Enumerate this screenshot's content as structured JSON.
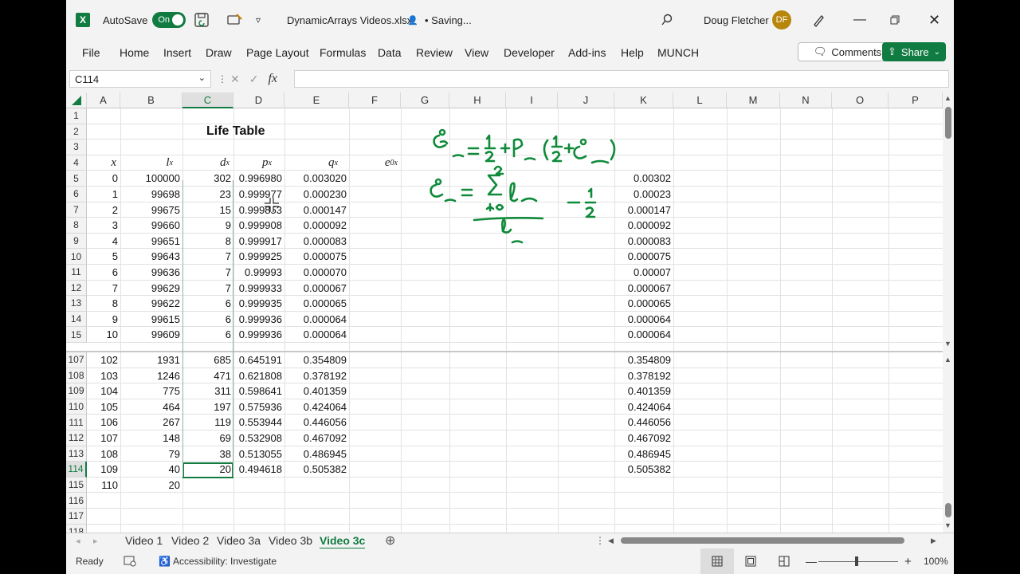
{
  "titlebar": {
    "autosave_label": "AutoSave",
    "autosave_state": "On",
    "file_name": "DynamicArrays Videos.xlsx",
    "save_status": "• Saving...",
    "user_name": "Doug Fletcher",
    "user_initials": "DF"
  },
  "ribbon": {
    "tabs": [
      "File",
      "Home",
      "Insert",
      "Draw",
      "Page Layout",
      "Formulas",
      "Data",
      "Review",
      "View",
      "Developer",
      "Add-ins",
      "Help",
      "MUNCH"
    ],
    "comments_label": "Comments",
    "share_label": "Share"
  },
  "formula_bar": {
    "name_box": "C114",
    "fx_label": "fx",
    "content": ""
  },
  "columns": [
    "A",
    "B",
    "C",
    "D",
    "E",
    "F",
    "G",
    "H",
    "I",
    "J",
    "K",
    "L",
    "M",
    "N",
    "O",
    "P"
  ],
  "selected_column": "C",
  "rows_top": [
    "1",
    "2",
    "3",
    "4",
    "5",
    "6",
    "7",
    "8",
    "9",
    "10",
    "11",
    "12",
    "13",
    "14",
    "15"
  ],
  "rows_bottom": [
    "107",
    "108",
    "109",
    "110",
    "111",
    "112",
    "113",
    "114",
    "115",
    "116",
    "117",
    "118"
  ],
  "selected_row": "114",
  "sheet": {
    "title": "Life Table",
    "headers": {
      "x": "x",
      "lx": "l",
      "lx_sub": "x",
      "dx": "d",
      "dx_sub": "x",
      "px": "p",
      "px_sub": "x",
      "qx": "q",
      "qx_sub": "x",
      "ex": "e",
      "ex_sub": "x",
      "ex_sup": "0"
    },
    "top_rows": [
      [
        "0",
        "100000",
        "302",
        "0.996980",
        "0.003020",
        "0.00302"
      ],
      [
        "1",
        "99698",
        "23",
        "0.999977",
        "0.000230",
        "0.00023"
      ],
      [
        "2",
        "99675",
        "15",
        "0.999853",
        "0.000147",
        "0.000147"
      ],
      [
        "3",
        "99660",
        "9",
        "0.999908",
        "0.000092",
        "0.000092"
      ],
      [
        "4",
        "99651",
        "8",
        "0.999917",
        "0.000083",
        "0.000083"
      ],
      [
        "5",
        "99643",
        "7",
        "0.999925",
        "0.000075",
        "0.000075"
      ],
      [
        "6",
        "99636",
        "7",
        "0.99993",
        "0.000070",
        "0.00007"
      ],
      [
        "7",
        "99629",
        "7",
        "0.999933",
        "0.000067",
        "0.000067"
      ],
      [
        "8",
        "99622",
        "6",
        "0.999935",
        "0.000065",
        "0.000065"
      ],
      [
        "9",
        "99615",
        "6",
        "0.999936",
        "0.000064",
        "0.000064"
      ],
      [
        "10",
        "99609",
        "6",
        "0.999936",
        "0.000064",
        "0.000064"
      ]
    ],
    "bottom_rows": [
      [
        "102",
        "1931",
        "685",
        "0.645191",
        "0.354809",
        "0.354809"
      ],
      [
        "103",
        "1246",
        "471",
        "0.621808",
        "0.378192",
        "0.378192"
      ],
      [
        "104",
        "775",
        "311",
        "0.598641",
        "0.401359",
        "0.401359"
      ],
      [
        "105",
        "464",
        "197",
        "0.575936",
        "0.424064",
        "0.424064"
      ],
      [
        "106",
        "267",
        "119",
        "0.553944",
        "0.446056",
        "0.446056"
      ],
      [
        "107",
        "148",
        "69",
        "0.532908",
        "0.467092",
        "0.467092"
      ],
      [
        "108",
        "79",
        "38",
        "0.513055",
        "0.486945",
        "0.486945"
      ],
      [
        "109",
        "40",
        "20",
        "0.494618",
        "0.505382",
        "0.505382"
      ],
      [
        "110",
        "20",
        "",
        "",
        "",
        ""
      ]
    ]
  },
  "sheet_tabs": [
    "Video 1",
    "Video 2",
    "Video 3a",
    "Video 3b",
    "Video 3c"
  ],
  "active_sheet": "Video 3c",
  "status": {
    "ready": "Ready",
    "accessibility": "Accessibility: Investigate",
    "zoom": "100%"
  },
  "colors": {
    "accent": "#107c41",
    "ink": "#0f8a3a"
  }
}
